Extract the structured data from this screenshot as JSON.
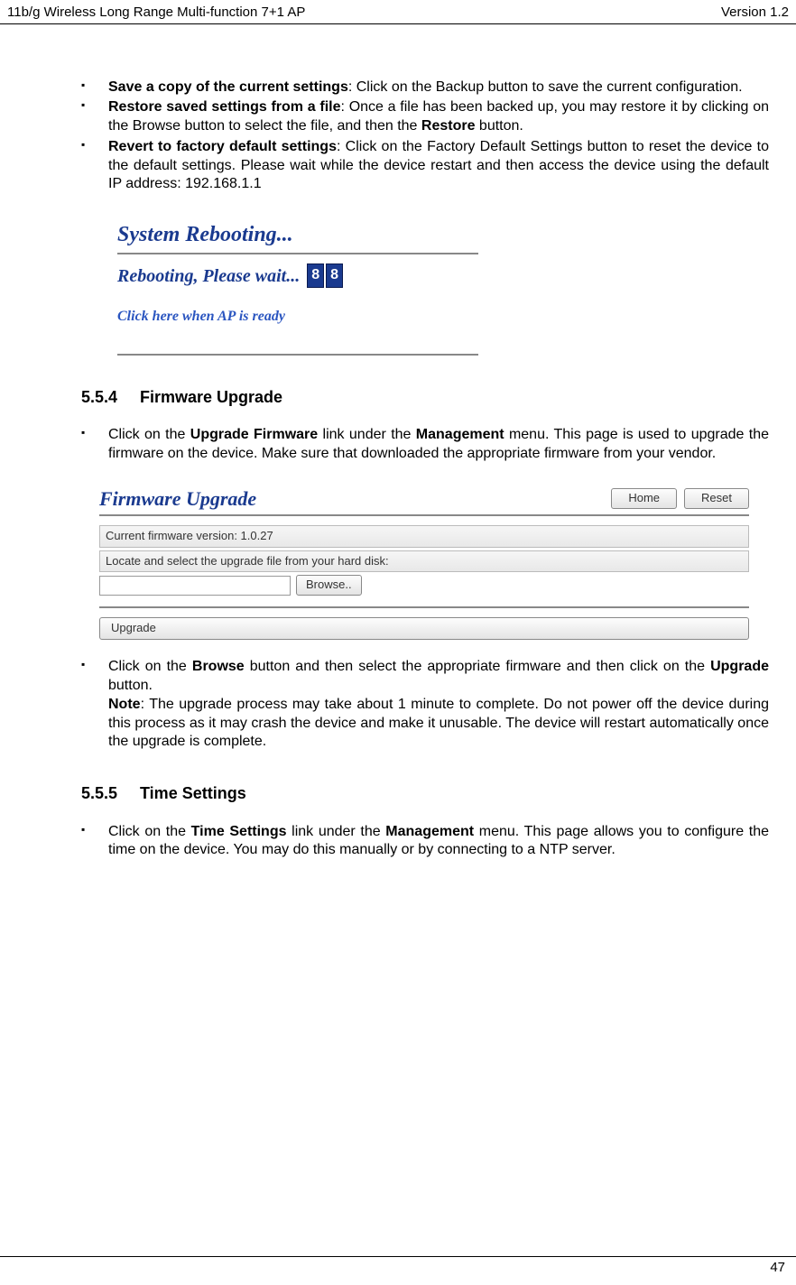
{
  "header": {
    "left": "11b/g Wireless Long Range Multi-function 7+1 AP",
    "right": "Version 1.2"
  },
  "bullets1": {
    "b1": {
      "bold": "Save a copy of the current settings",
      "rest": ": Click on the Backup button to save the current configuration."
    },
    "b2": {
      "bold": "Restore saved settings from a file",
      "rest1": ": Once a file has been backed up, you may restore it by clicking on the Browse button to select the file, and then the ",
      "bold2": "Restore",
      "rest2": " button."
    },
    "b3": {
      "bold": "Revert to factory default settings",
      "rest": ": Click on the Factory Default Settings button to reset the device to the default settings. Please wait while the device restart and then access the device using the default IP address: 192.168.1.1"
    }
  },
  "shot1": {
    "title": "System Rebooting...",
    "wait": "Rebooting, Please wait...",
    "counter": [
      "8",
      "8"
    ],
    "ready": "Click here when AP is ready"
  },
  "sec554": {
    "num": "5.5.4",
    "title": "Firmware Upgrade"
  },
  "bullets2": {
    "b1": {
      "pre": "Click on the ",
      "bold1": "Upgrade Firmware",
      "mid": " link under the ",
      "bold2": "Management",
      "post": " menu. This page is used to upgrade the firmware on the device. Make sure that downloaded the appropriate firmware from your vendor."
    }
  },
  "shot2": {
    "title": "Firmware Upgrade",
    "home": "Home",
    "reset": "Reset",
    "row1": "Current firmware version: 1.0.27",
    "row2": "Locate and select the upgrade file from your hard disk:",
    "browse": "Browse..",
    "upgrade": "Upgrade"
  },
  "bullets3": {
    "b1": {
      "pre": "Click on the ",
      "bold1": "Browse",
      "mid": " button and then select the appropriate firmware and then click on the ",
      "bold2": "Upgrade",
      "post": " button."
    },
    "note": {
      "bold": "Note",
      "rest": ": The upgrade process may take about 1 minute to complete. Do not power off the device during this process as it may crash the device and make it unusable. The device will restart automatically once the upgrade is complete."
    }
  },
  "sec555": {
    "num": "5.5.5",
    "title": "Time Settings"
  },
  "bullets4": {
    "b1": {
      "pre": "Click on the ",
      "bold1": "Time Settings",
      "mid": " link under the ",
      "bold2": "Management",
      "post": " menu. This page allows you to configure the time on the device. You may do this manually or by connecting to a NTP server."
    }
  },
  "footer": {
    "page": "47"
  }
}
